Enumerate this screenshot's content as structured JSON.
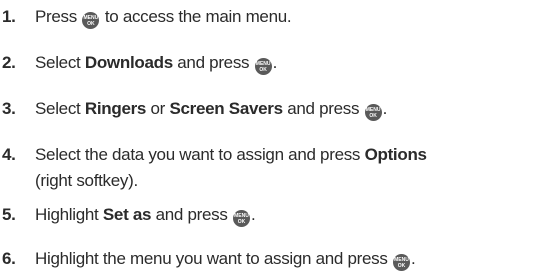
{
  "steps": [
    {
      "number": "1.",
      "pre": "Press ",
      "post": " to access the main menu."
    },
    {
      "number": "2.",
      "pre": "Select ",
      "bold1": "Downloads",
      "mid": " and press ",
      "post": "."
    },
    {
      "number": "3.",
      "pre": "Select ",
      "bold1": "Ringers",
      "mid1": " or ",
      "bold2": "Screen Savers",
      "mid2": " and press ",
      "post": "."
    },
    {
      "number": "4.",
      "line1_pre": "Select the data you want to assign and press ",
      "bold1": "Options",
      "line2": "(right softkey)."
    },
    {
      "number": "5.",
      "pre": "Highlight ",
      "bold1": "Set as",
      "mid": " and press ",
      "post": "."
    },
    {
      "number": "6.",
      "pre": "Highlight the menu you want to assign and press ",
      "post": "."
    }
  ],
  "menu_key": {
    "line1": "MENU",
    "line2": "OK",
    "icon": "menu-ok-key-icon"
  }
}
